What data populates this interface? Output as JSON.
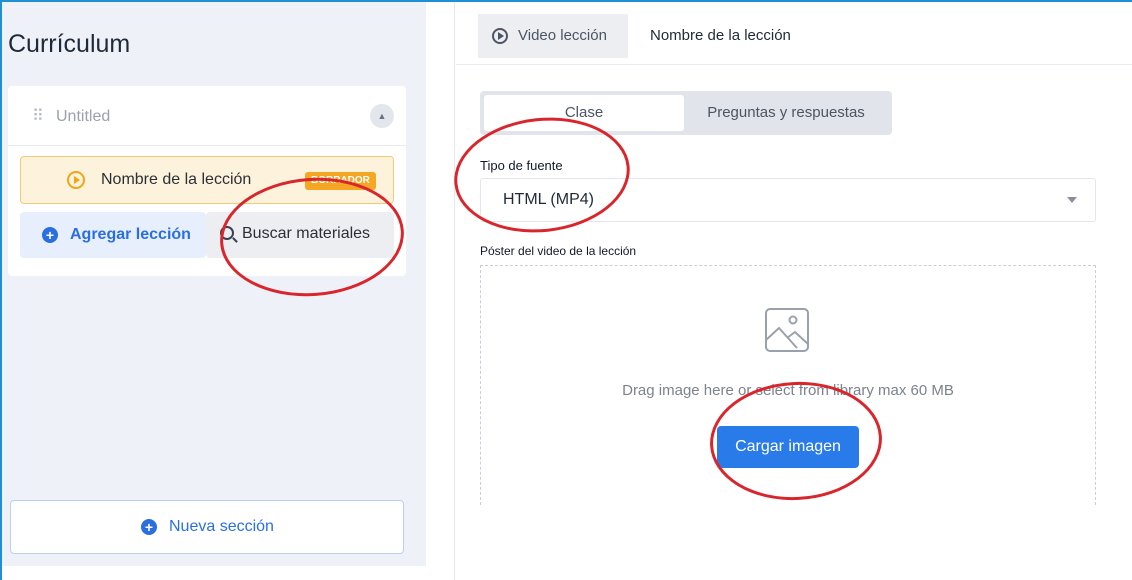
{
  "sidebar": {
    "title": "Currículum",
    "section": {
      "name": "Untitled",
      "lesson": {
        "name": "Nombre de la lección",
        "badge": "BORRADOR"
      },
      "add_lesson_label": "Agregar lección",
      "search_materials_label": "Buscar materiales"
    },
    "new_section_label": "Nueva sección"
  },
  "editor": {
    "lesson_type_tab": "Video lección",
    "lesson_title": "Nombre de la lección",
    "tabs": [
      "Clase",
      "Preguntas y respuestas"
    ],
    "source_type": {
      "label": "Tipo de fuente",
      "value": "HTML (MP4)"
    },
    "poster": {
      "label": "Póster del video de la lección",
      "hint": "Drag image here or select from library max 60 MB",
      "upload_label": "Cargar imagen"
    }
  },
  "colors": {
    "accent": "#2a7bea",
    "draft_badge": "#f5a623",
    "annotation": "#d8262c"
  },
  "icons": [
    "drag-handle-icon",
    "chevron-up-icon",
    "play-circle-icon",
    "plus-circle-icon",
    "search-icon",
    "chevron-down-icon",
    "image-placeholder-icon"
  ]
}
